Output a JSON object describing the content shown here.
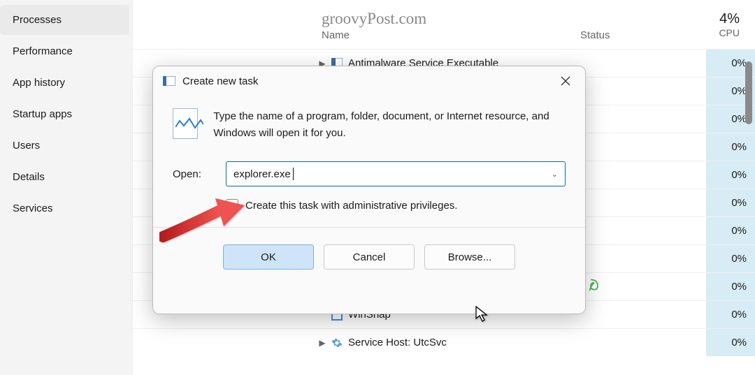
{
  "watermark": "groovyPost.com",
  "sidebar": {
    "items": [
      {
        "label": "Processes",
        "active": true
      },
      {
        "label": "Performance",
        "active": false
      },
      {
        "label": "App history",
        "active": false
      },
      {
        "label": "Startup apps",
        "active": false
      },
      {
        "label": "Users",
        "active": false
      },
      {
        "label": "Details",
        "active": false
      },
      {
        "label": "Services",
        "active": false
      }
    ]
  },
  "columns": {
    "name": "Name",
    "status": "Status",
    "cpu_percent": "4%",
    "cpu_label": "CPU"
  },
  "processes": {
    "first": {
      "name": "Antimalware Service Executable",
      "cpu": "0%"
    },
    "hidden_cpu": "0%",
    "winsnap": {
      "name": "WinSnap",
      "cpu": "0%"
    },
    "utcsvc": {
      "name": "Service Host: UtcSvc",
      "cpu": "0%"
    }
  },
  "dialog": {
    "title": "Create new task",
    "description": "Type the name of a program, folder, document, or Internet resource, and Windows will open it for you.",
    "open_label": "Open:",
    "open_value": "explorer.exe",
    "admin_label": "Create this task with administrative privileges.",
    "buttons": {
      "ok": "OK",
      "cancel": "Cancel",
      "browse": "Browse..."
    }
  }
}
